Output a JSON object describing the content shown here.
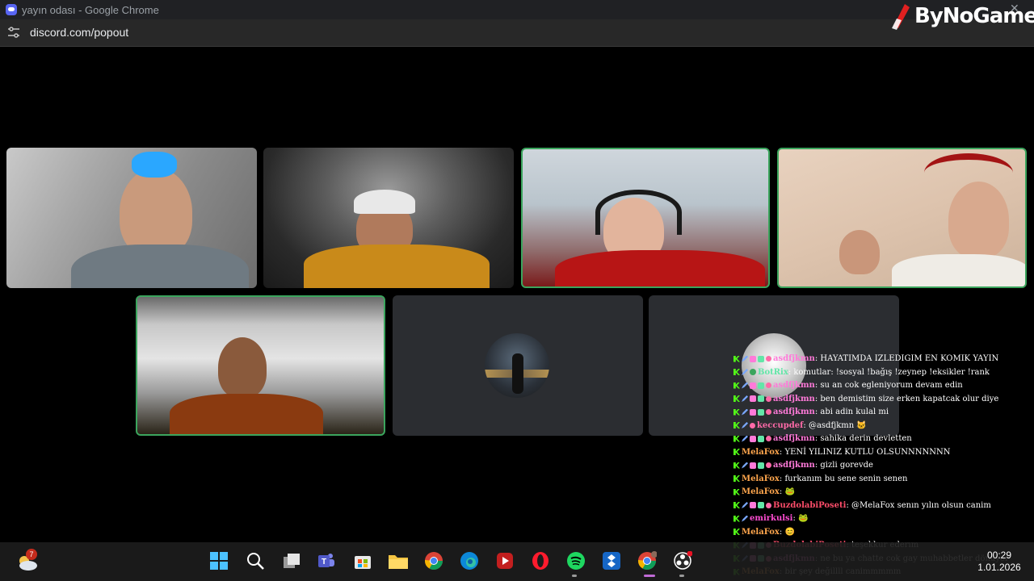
{
  "window": {
    "title": "yayın odası - Google Chrome",
    "url": "discord.com/popout",
    "close_glyph": "✕"
  },
  "watermark": {
    "text": "ByNoGame"
  },
  "tiles": [
    {
      "id": "user-1",
      "speaking": false
    },
    {
      "id": "user-2",
      "speaking": false
    },
    {
      "id": "user-3",
      "speaking": true
    },
    {
      "id": "user-4",
      "speaking": true
    },
    {
      "id": "user-5",
      "speaking": true
    },
    {
      "id": "user-6",
      "speaking": false,
      "avatar_only": true
    },
    {
      "id": "user-7",
      "speaking": false,
      "avatar_only": true
    }
  ],
  "chat": [
    {
      "badges": [
        "k",
        "s",
        "h",
        "g",
        "c"
      ],
      "user": "asdfjkmn",
      "color": "#ff7ad9",
      "text": "HAYATIMDA IZLEDIGIM EN KOMIK YAYIN"
    },
    {
      "badges": [
        "k",
        "s",
        "o"
      ],
      "user": "BotRix",
      "color": "#63e6a8",
      "text": "komutlar: !sosyal !bağış !zeynep !eksikler !rank"
    },
    {
      "badges": [
        "k",
        "s",
        "h",
        "g",
        "c"
      ],
      "user": "asdfjkmn",
      "color": "#ff7ad9",
      "text": "su an cok egleniyorum devam edin"
    },
    {
      "badges": [
        "k",
        "s",
        "h",
        "g",
        "c"
      ],
      "user": "asdfjkmn",
      "color": "#ff7ad9",
      "text": "ben demistim size erken kapatcak olur diye"
    },
    {
      "badges": [
        "k",
        "s",
        "h",
        "g",
        "c"
      ],
      "user": "asdfjkmn",
      "color": "#ff7ad9",
      "text": "abi adin kulal mi"
    },
    {
      "badges": [
        "k",
        "s",
        "c"
      ],
      "user": "keccupdef",
      "color": "#ff6aa8",
      "text": "@asdfjkmn 🐱"
    },
    {
      "badges": [
        "k",
        "s",
        "h",
        "g",
        "c"
      ],
      "user": "asdfjkmn",
      "color": "#ff7ad9",
      "text": "sahika derin devletten"
    },
    {
      "badges": [
        "k"
      ],
      "user": "MelaFox",
      "color": "#ffa64d",
      "text": "YENİ YILINIZ KUTLU OLSUNNNNNNN"
    },
    {
      "badges": [
        "k",
        "s",
        "h",
        "g",
        "c"
      ],
      "user": "asdfjkmn",
      "color": "#ff7ad9",
      "text": "gizli gorevde"
    },
    {
      "badges": [
        "k"
      ],
      "user": "MelaFox",
      "color": "#ffa64d",
      "text": "furkanım bu sene senin senen"
    },
    {
      "badges": [
        "k"
      ],
      "user": "MelaFox",
      "color": "#ffa64d",
      "text": "🐸"
    },
    {
      "badges": [
        "k",
        "s",
        "h",
        "g",
        "c"
      ],
      "user": "BuzdolabiPoseti",
      "color": "#ff4d6a",
      "text": "@MelaFox senın yılın olsun canim"
    },
    {
      "badges": [
        "k",
        "s"
      ],
      "user": "emirkulsi",
      "color": "#ff4dd2",
      "text": "🐸"
    },
    {
      "badges": [
        "k"
      ],
      "user": "MelaFox",
      "color": "#ffa64d",
      "text": "😊"
    },
    {
      "badges": [
        "k",
        "s",
        "h",
        "g",
        "c"
      ],
      "user": "BuzdolabiPoseti",
      "color": "#ff4d6a",
      "text": "teşekkur ederım"
    },
    {
      "badges": [
        "k",
        "s",
        "h",
        "g",
        "c"
      ],
      "user": "asdfjkmn",
      "color": "#ff7ad9",
      "text": "ne bu ya chatte cok gay muhabbetler dönuyor"
    },
    {
      "badges": [
        "k"
      ],
      "user": "MelaFox",
      "color": "#ffa64d",
      "text": "bir şey değillll canimmmmm"
    }
  ],
  "taskbar": {
    "weather_badge": "7",
    "apps": [
      "windows-start",
      "search",
      "task-view",
      "teams",
      "store",
      "file-explorer",
      "chrome",
      "edge",
      "media-player",
      "opera",
      "spotify",
      "remote-app",
      "chrome-active",
      "obs"
    ],
    "time": "00:29",
    "date": "1.01.2026"
  }
}
